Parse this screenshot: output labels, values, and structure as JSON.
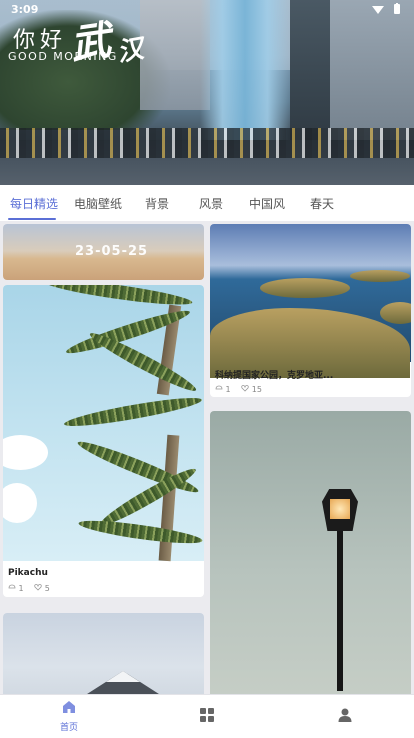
{
  "status": {
    "time": "3:09",
    "icons": "▾ ▮"
  },
  "header": {
    "greeting_cn": "你好",
    "greeting_big1": "武",
    "greeting_big2": "汉",
    "greeting_en": "GOOD MORNING"
  },
  "tabs": [
    {
      "label": "每日精选"
    },
    {
      "label": "电脑壁纸"
    },
    {
      "label": "背景"
    },
    {
      "label": "风景"
    },
    {
      "label": "中国风"
    },
    {
      "label": "春天"
    }
  ],
  "feed": {
    "date_overlay": "23-05-25",
    "items": [
      {
        "title": "Pikachu",
        "downloads": "1",
        "likes": "5"
      },
      {
        "title": "科纳提国家公园，克罗地亚...",
        "downloads": "1",
        "likes": "15"
      }
    ]
  },
  "nav": {
    "home_label": "首页",
    "accent": "#5b6fd6"
  }
}
